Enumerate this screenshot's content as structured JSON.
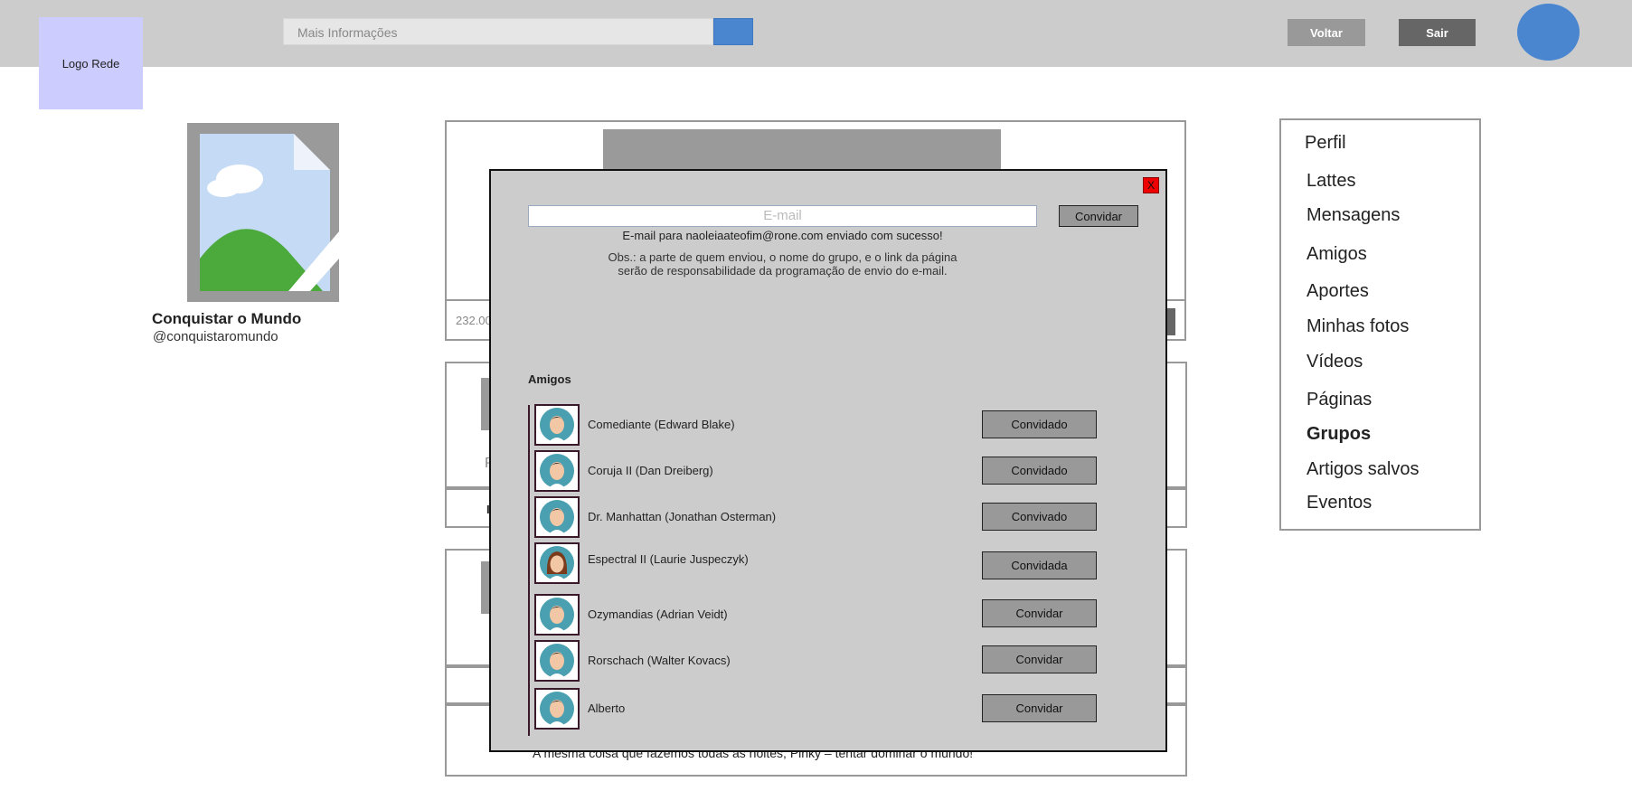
{
  "header": {
    "logo": "Logo Rede",
    "search_placeholder": "Mais Informações",
    "back_label": "Voltar",
    "exit_label": "Sair"
  },
  "profile": {
    "name": "Conquistar o Mundo",
    "handle": "@conquistaromundo"
  },
  "feed": {
    "stat_fragment": "232.00",
    "row_fragment_a": "P",
    "row_fragment_b": "I",
    "footer_text": "A mesma coisa que fazemos todas as noites, Pinky – tentar dominar o mundo!"
  },
  "menu": {
    "items": [
      {
        "label": "Perfil"
      },
      {
        "label": "Lattes"
      },
      {
        "label": "Mensagens"
      },
      {
        "label": "Amigos"
      },
      {
        "label": "Aportes"
      },
      {
        "label": "Minhas fotos"
      },
      {
        "label": "Vídeos"
      },
      {
        "label": "Páginas"
      },
      {
        "label": "Grupos"
      },
      {
        "label": "Artigos salvos"
      },
      {
        "label": "Eventos"
      }
    ]
  },
  "modal": {
    "close_label": "X",
    "email_placeholder": "E-mail",
    "invite_label": "Convidar",
    "success_message": "E-mail para naoleiaateofim@rone.com enviado com sucesso!",
    "obs_line1": "Obs.: a parte de quem enviou, o nome do grupo, e o link da página",
    "obs_line2": "serão de responsabilidade da programação de envio do e-mail.",
    "friends_title": "Amigos",
    "friends": [
      {
        "name": "Comediante (Edward Blake)",
        "status": "Convidado",
        "avatar": "male-avatar-icon"
      },
      {
        "name": "Coruja II (Dan Dreiberg)",
        "status": "Convidado",
        "avatar": "male-avatar-icon"
      },
      {
        "name": "Dr. Manhattan (Jonathan Osterman)",
        "status": "Convivado",
        "avatar": "male-avatar-icon"
      },
      {
        "name": "Espectral II (Laurie Juspeczyk)",
        "status": "Convidada",
        "avatar": "female-avatar-icon"
      },
      {
        "name": "Ozymandias (Adrian Veidt)",
        "status": "Convidar",
        "avatar": "male-avatar-icon"
      },
      {
        "name": "Rorschach (Walter Kovacs)",
        "status": "Convidar",
        "avatar": "male-avatar-icon"
      },
      {
        "name": "Alberto",
        "status": "Convidar",
        "avatar": "male-avatar-icon"
      }
    ]
  },
  "colors": {
    "accent": "#4a86d0",
    "logo_bg": "#ccccff",
    "modal_bg": "#cccccc",
    "close_red": "#ee0000"
  }
}
